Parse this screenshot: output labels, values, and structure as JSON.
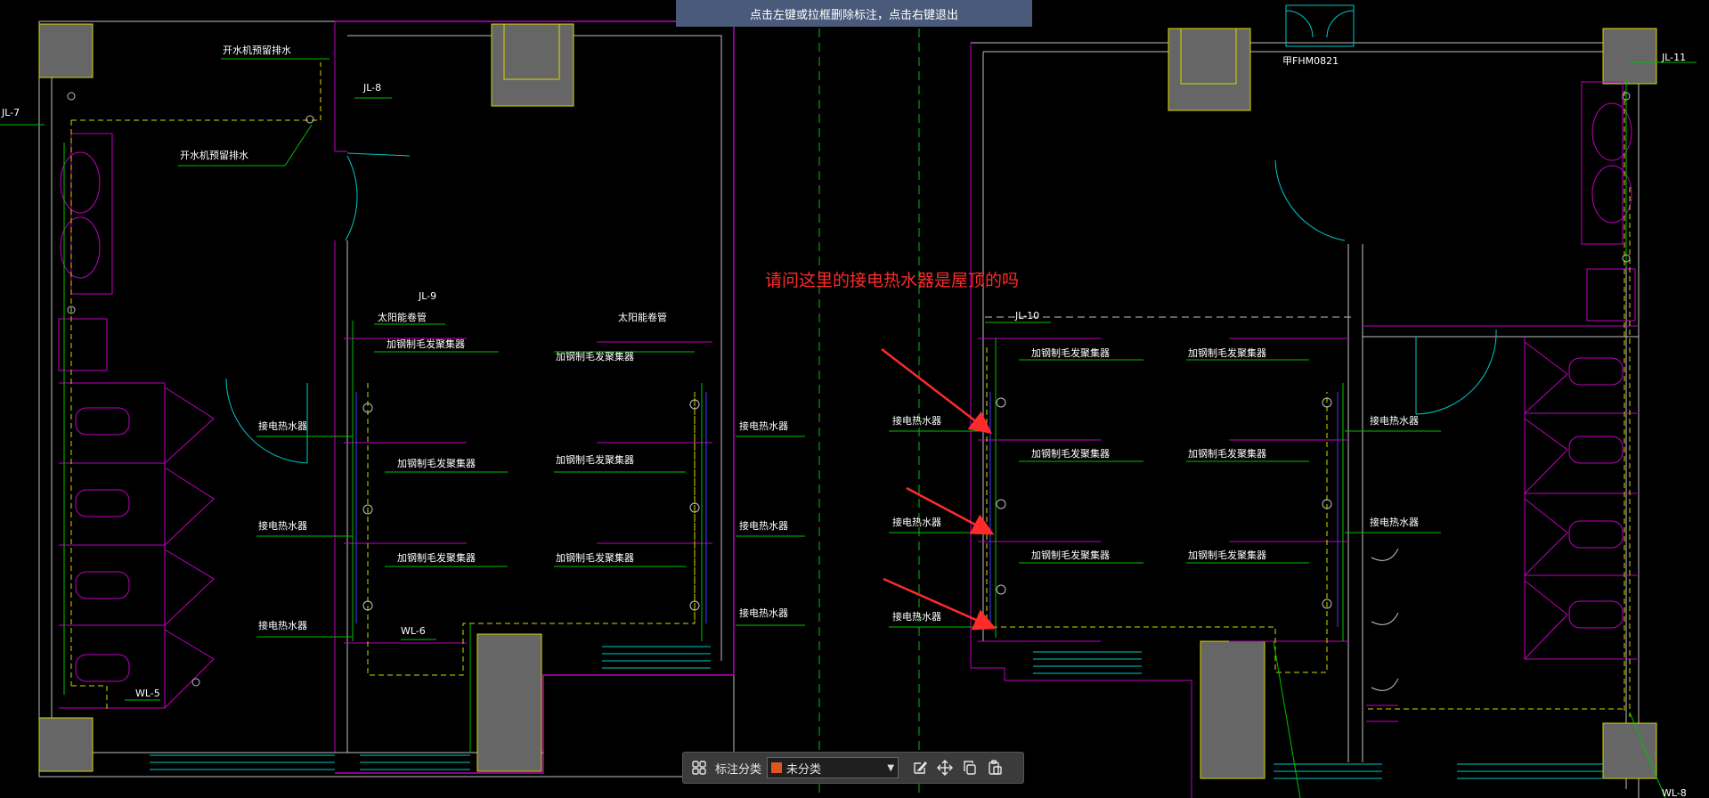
{
  "tip_bar": {
    "text": "点击左键或拉框删除标注，点击右键退出"
  },
  "annotation": {
    "text": "请问这里的接电热水器是屋顶的吗"
  },
  "toolbar": {
    "category_label": "标注分类",
    "category_value": "未分类",
    "category_color": "#e0561f"
  },
  "drawing": {
    "pipe_labels": {
      "jl7": "JL-7",
      "jl8": "JL-8",
      "jl9": "JL-9",
      "jl10": "JL-10",
      "jl11": "JL-11",
      "wl5": "WL-5",
      "wl6": "WL-6",
      "wl8": "WL-8"
    },
    "door_code": "甲FHM0821",
    "drain_top": "开水机预留排水",
    "drain_bottom": "开水机预留排水",
    "solar_pipe": "太阳能卷管",
    "collector": "加钢制毛发聚集器",
    "heater": "接电热水器"
  }
}
